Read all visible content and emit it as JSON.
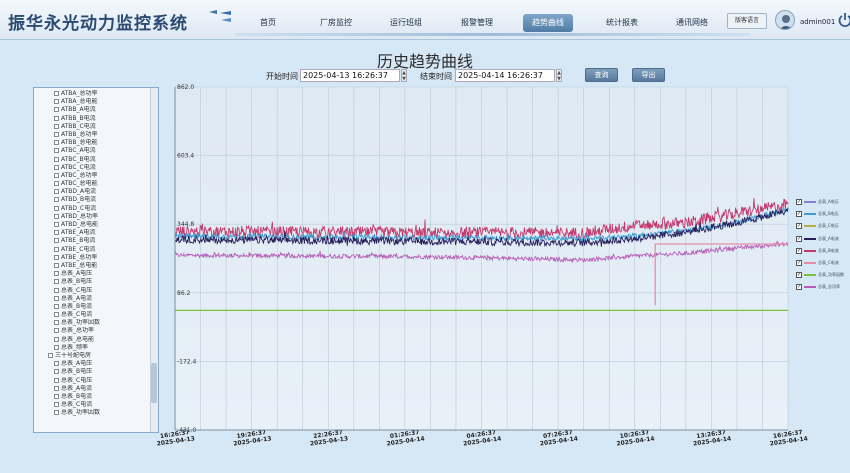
{
  "app": {
    "title": "振华永光动力监控系统"
  },
  "nav": {
    "items": [
      {
        "label": "首页",
        "active": false
      },
      {
        "label": "厂房监控",
        "active": false
      },
      {
        "label": "运行班组",
        "active": false
      },
      {
        "label": "报警管理",
        "active": false
      },
      {
        "label": "趋势曲线",
        "active": true
      },
      {
        "label": "统计报表",
        "active": false
      },
      {
        "label": "通讯网络",
        "active": false
      }
    ],
    "lang_label": "版客语言",
    "username": "admin001"
  },
  "page": {
    "title": "历史趋势曲线",
    "start_label": "开始时间",
    "start_value": "2025-04-13 16:26:37",
    "end_label": "结束时间",
    "end_value": "2025-04-14 16:26:37",
    "query_label": "查询",
    "export_label": "导出"
  },
  "tree": {
    "items": [
      "ATBA_总功率",
      "ATBA_总电能",
      "ATBB_A电流",
      "ATBB_B电流",
      "ATBB_C电流",
      "ATBB_总功率",
      "ATBB_总电能",
      "ATBC_A电流",
      "ATBC_B电流",
      "ATBC_C电流",
      "ATBC_总功率",
      "ATBC_总电能",
      "ATBD_A电流",
      "ATBD_B电流",
      "ATBD_C电流",
      "ATBD_总功率",
      "ATBD_总电能",
      "ATBE_A电流",
      "ATBE_B电流",
      "ATBE_C电流",
      "ATBE_总功率",
      "ATBE_总电能",
      "总表_A电压",
      "总表_B电压",
      "总表_C电压",
      "总表_A电流",
      "总表_B电流",
      "总表_C电流",
      "总表_功率因数",
      "总表_总功率",
      "总表_总电能",
      "总表_频率",
      "三十号配电房",
      "总表_A电压",
      "总表_B电压",
      "总表_C电压",
      "总表_A电流",
      "总表_B电流",
      "总表_C电流",
      "总表_功率因数"
    ]
  },
  "chart_data": {
    "type": "line",
    "y_ticks": [
      "862.0",
      "603.4",
      "344.8",
      "86.2",
      "-172.4",
      "-431.0"
    ],
    "ylim": [
      -431.0,
      862.0
    ],
    "x_ticks": [
      {
        "time": "16:26:37",
        "date": "2025-04-13"
      },
      {
        "time": "19:26:37",
        "date": "2025-04-13"
      },
      {
        "time": "22:26:37",
        "date": "2025-04-13"
      },
      {
        "time": "01:26:37",
        "date": "2025-04-14"
      },
      {
        "time": "04:26:37",
        "date": "2025-04-14"
      },
      {
        "time": "07:26:37",
        "date": "2025-04-14"
      },
      {
        "time": "10:26:37",
        "date": "2025-04-14"
      },
      {
        "time": "13:26:37",
        "date": "2025-04-14"
      },
      {
        "time": "16:26:37",
        "date": "2025-04-14"
      }
    ],
    "xlim_hours": [
      0,
      24
    ],
    "grid": true,
    "legend_placement": "right",
    "series": [
      {
        "name": "总表_A电压",
        "color": "#8a7ed0",
        "checked": true,
        "style": "flat",
        "points": [
          [
            0,
            0
          ],
          [
            24,
            0
          ]
        ]
      },
      {
        "name": "总表_B电压",
        "color": "#3f9bd0",
        "checked": true,
        "style": "noisy",
        "points": [
          [
            0,
            300
          ],
          [
            10,
            295
          ],
          [
            16,
            290
          ],
          [
            18,
            300
          ],
          [
            20,
            320
          ],
          [
            22,
            350
          ],
          [
            24,
            400
          ]
        ],
        "noise": 10
      },
      {
        "name": "总表_C电压",
        "color": "#b8b040",
        "checked": true,
        "style": "flat",
        "points": [
          [
            0,
            0
          ],
          [
            24,
            0
          ]
        ]
      },
      {
        "name": "总表_A电流",
        "color": "#2a1f5a",
        "checked": true,
        "style": "noisy",
        "points": [
          [
            0,
            287
          ],
          [
            10,
            280
          ],
          [
            16,
            275
          ],
          [
            18,
            290
          ],
          [
            20,
            315
          ],
          [
            22,
            350
          ],
          [
            24,
            395
          ]
        ],
        "noise": 14
      },
      {
        "name": "总表_B电流",
        "color": "#c23a6e",
        "checked": true,
        "style": "noisy",
        "points": [
          [
            0,
            318
          ],
          [
            10,
            312
          ],
          [
            16,
            312
          ],
          [
            18,
            340
          ],
          [
            20,
            350
          ],
          [
            22,
            385
          ],
          [
            24,
            420
          ]
        ],
        "noise": 22
      },
      {
        "name": "总表_C电流",
        "color": "#e48fa8",
        "checked": true,
        "style": "step",
        "points": [
          [
            18.8,
            270
          ],
          [
            18.8,
            230
          ],
          [
            18.8,
            40
          ],
          [
            18.8,
            270
          ],
          [
            24,
            270
          ]
        ]
      },
      {
        "name": "总表_功率因数",
        "color": "#7fbf3a",
        "checked": true,
        "style": "flat",
        "points": [
          [
            0,
            20
          ],
          [
            24,
            20
          ]
        ]
      },
      {
        "name": "总表_总功率",
        "color": "#b55fb8",
        "checked": true,
        "style": "noisy",
        "points": [
          [
            0,
            228
          ],
          [
            10,
            222
          ],
          [
            16,
            210
          ],
          [
            18,
            225
          ],
          [
            20,
            235
          ],
          [
            22,
            255
          ],
          [
            24,
            270
          ]
        ],
        "noise": 8
      }
    ]
  }
}
